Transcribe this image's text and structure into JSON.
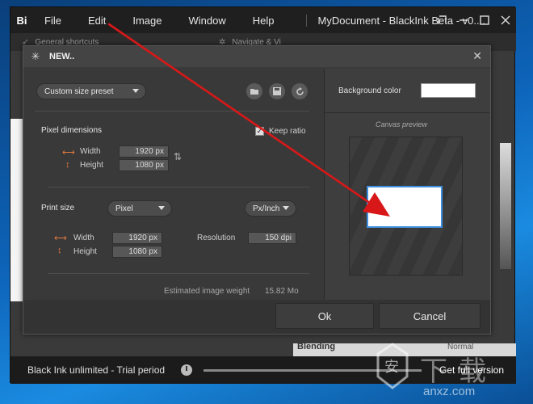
{
  "app": {
    "logo": "Bi",
    "menu": [
      "File",
      "Edit",
      "Image",
      "Window",
      "Help"
    ],
    "doc_title": "MyDocument - BlackInk Beta - v0....",
    "tabs": [
      "General shortcuts",
      "Navigate & Vi"
    ],
    "bottom": {
      "trial": "Black Ink unlimited - Trial period",
      "full_version": "Get full version"
    },
    "blending": "Blending",
    "normal": "Normal"
  },
  "dialog": {
    "title": "NEW..",
    "preset": "Custom size preset",
    "pixel_dimensions": {
      "label": "Pixel dimensions",
      "keep_ratio": "Keep ratio",
      "width_label": "Width",
      "width_value": "1920 px",
      "height_label": "Height",
      "height_value": "1080 px"
    },
    "print_size": {
      "label": "Print size",
      "unit": "Pixel",
      "res_unit": "Px/Inch",
      "width_label": "Width",
      "width_value": "1920 px",
      "height_label": "Height",
      "height_value": "1080 px",
      "resolution_label": "Resolution",
      "resolution_value": "150 dpi"
    },
    "estimated_label": "Estimated image weight",
    "estimated_value": "15.82 Mo",
    "background_color_label": "Background color",
    "background_color": "#ffffff",
    "canvas_preview_label": "Canvas preview",
    "ok": "Ok",
    "cancel": "Cancel"
  },
  "watermark": {
    "char1": "安",
    "char2": "下",
    "char3": "载",
    "domain": "anxz.com"
  },
  "colors": {
    "accent": "#e07a3e",
    "arrow": "#d81818",
    "preview_border": "#3f8fe0"
  }
}
